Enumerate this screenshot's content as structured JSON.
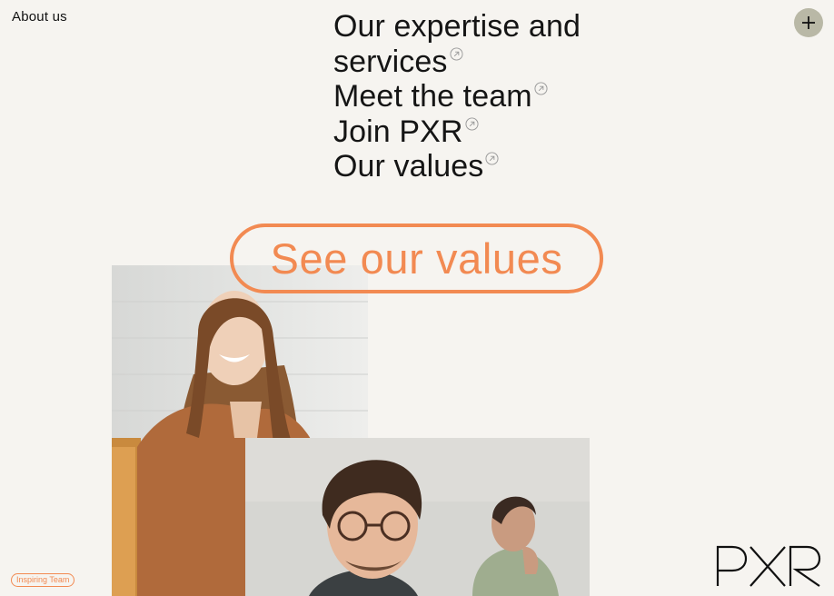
{
  "header": {
    "section_label": "About us",
    "open_menu_icon": "plus-icon"
  },
  "menu": {
    "items": [
      {
        "label": "Our expertise and services",
        "icon": "arrow-up-right-circle-icon"
      },
      {
        "label": "Meet the team",
        "icon": "arrow-up-right-circle-icon"
      },
      {
        "label": "Join PXR",
        "icon": "arrow-up-right-circle-icon"
      },
      {
        "label": "Our values",
        "icon": "arrow-up-right-circle-icon"
      }
    ]
  },
  "cta": {
    "label": "See our values"
  },
  "tag": {
    "label": "Inspiring Team"
  },
  "brand": {
    "logo_text": "PXR"
  },
  "colors": {
    "accent": "#f28a52",
    "background": "#f6f4f0",
    "plus_button": "#b9b8a6",
    "text": "#151515"
  }
}
